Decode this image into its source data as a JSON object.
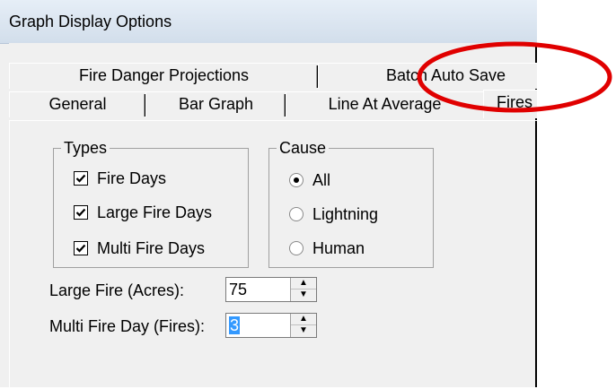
{
  "window": {
    "title": "Graph Display Options"
  },
  "tabs": {
    "back_row": [
      "Fire Danger Projections",
      "Batch Auto Save"
    ],
    "front_row": [
      "General",
      "Bar Graph",
      "Line At Average",
      "Fires"
    ],
    "selected": "Fires"
  },
  "types_group": {
    "title": "Types",
    "items": [
      {
        "label": "Fire Days",
        "checked": true
      },
      {
        "label": "Large Fire Days",
        "checked": true
      },
      {
        "label": "Multi Fire Days",
        "checked": true
      }
    ]
  },
  "cause_group": {
    "title": "Cause",
    "options": [
      "All",
      "Lightning",
      "Human"
    ],
    "selected": "All"
  },
  "fields": {
    "large_fire_label": "Large Fire (Acres):",
    "large_fire_value": "75",
    "multi_fire_label": "Multi Fire Day (Fires):",
    "multi_fire_value": "3"
  },
  "colors": {
    "annotation": "#e00000",
    "selection": "#3399ff"
  }
}
